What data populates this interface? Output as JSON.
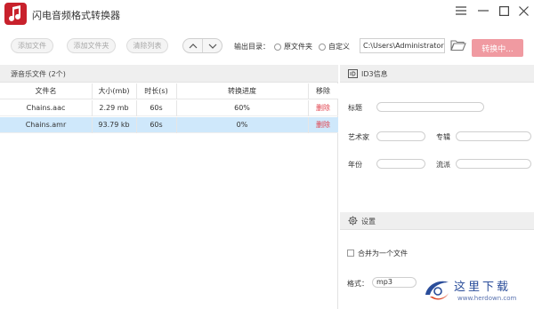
{
  "app": {
    "title": "闪电音频格式转换器"
  },
  "toolbar": {
    "add_file": "添加文件",
    "add_folder": "添加文件夹",
    "clear_list": "清除列表",
    "output_label": "输出目录：",
    "option_source": "原文件夹",
    "option_custom": "自定义",
    "output_path": "C:\\Users\\Administrator",
    "convert_button": "转换中..."
  },
  "source": {
    "title": "源音乐文件 (2个)",
    "columns": [
      "文件名",
      "大小(mb)",
      "时长(s)",
      "转换进度",
      "移除"
    ],
    "rows": [
      {
        "name": "Chains.aac",
        "size": "2.29 mb",
        "duration": "60s",
        "progress": "60%",
        "remove": "删除"
      },
      {
        "name": "Chains.amr",
        "size": "93.79 kb",
        "duration": "60s",
        "progress": "0%",
        "remove": "删除"
      }
    ]
  },
  "id3": {
    "header": "ID3信息",
    "title_label": "标题",
    "artist_label": "艺术家",
    "album_label": "专辑",
    "year_label": "年份",
    "genre_label": "流派"
  },
  "settings": {
    "header": "设置",
    "merge_label": "合并为一个文件",
    "format_label": "格式：",
    "format_value": "mp3"
  },
  "watermark": {
    "text": "这里下载",
    "sub": "www.herdown.com"
  },
  "colors": {
    "brand": "#c8212c",
    "convert_button": "#f09aa1",
    "selected_row": "#cfe8fb",
    "delete_text": "#e0414c"
  }
}
